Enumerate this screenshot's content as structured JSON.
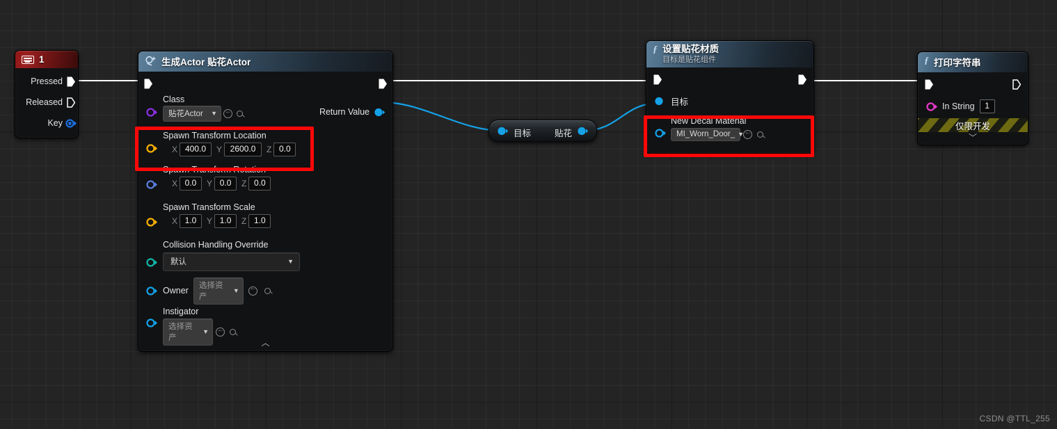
{
  "app": {
    "watermark": "CSDN @TTL_255"
  },
  "colors": {
    "exec_wire": "#ffffff",
    "data_wire": "#14a2e8",
    "highlight": "#fc0808",
    "pin_object": "#14a2e8",
    "pin_class": "#8b30e0",
    "pin_vector": "#ffb400",
    "pin_rotator": "#5b7fe0",
    "pin_enum": "#11b8a8",
    "pin_string": "#e838c8",
    "title_fn": "#3d5c73",
    "title_key": "#8f1616"
  },
  "nodes": {
    "keyboard_event": {
      "title": "1",
      "icon": "keyboard-icon",
      "pins": [
        {
          "label": "Pressed",
          "type": "exec",
          "connected": true
        },
        {
          "label": "Released",
          "type": "exec",
          "connected": false
        },
        {
          "label": "Key",
          "type": "struct",
          "connected": false
        }
      ]
    },
    "spawn_actor": {
      "title": "生成Actor 贴花Actor",
      "icon": "spawn-actor-icon",
      "exec_in": "",
      "exec_out": "",
      "return_label": "Return Value",
      "class_label": "Class",
      "class_value": "贴花Actor",
      "location": {
        "label": "Spawn Transform Location",
        "x_axis": "X",
        "x": "400.0",
        "y_axis": "Y",
        "y": "2600.0",
        "z_axis": "Z",
        "z": "0.0",
        "highlighted": true
      },
      "rotation": {
        "label": "Spawn Transform Rotation",
        "x_axis": "X",
        "x": "0.0",
        "y_axis": "Y",
        "y": "0.0",
        "z_axis": "Z",
        "z": "0.0"
      },
      "scale": {
        "label": "Spawn Transform Scale",
        "x_axis": "X",
        "x": "1.0",
        "y_axis": "Y",
        "y": "1.0",
        "z_axis": "Z",
        "z": "1.0"
      },
      "collision": {
        "label": "Collision Handling Override",
        "value": "默认"
      },
      "owner": {
        "label": "Owner",
        "value": "选择资产"
      },
      "instigator": {
        "label": "Instigator",
        "value": "选择资产"
      },
      "collapse_glyph": "︿"
    },
    "reroute_cast": {
      "input_label": "目标",
      "output_label": "贴花"
    },
    "set_decal_material": {
      "title": "设置贴花材质",
      "subtitle": "目标是贴花组件",
      "icon": "function-icon",
      "target_label": "目标",
      "material": {
        "label": "New Decal Material",
        "value": "MI_Worn_Door_",
        "highlighted": true
      }
    },
    "print_string": {
      "title": "打印字符串",
      "icon": "function-icon",
      "in_string_label": "In String",
      "in_string_value": "1",
      "dev_only_label": "仅限开发",
      "collapse_glyph": "﹀"
    }
  }
}
